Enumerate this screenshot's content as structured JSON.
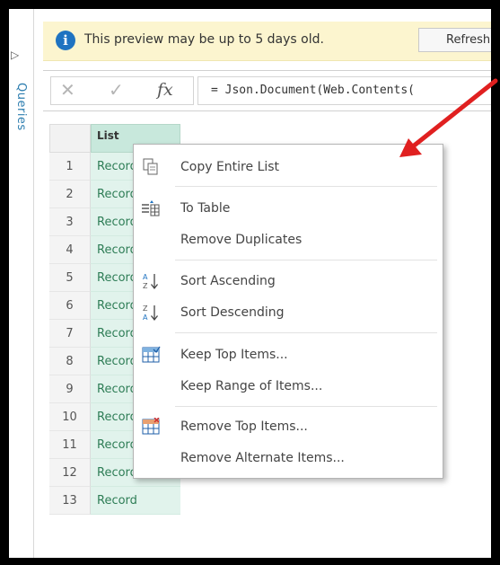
{
  "sidebar": {
    "label": "Queries"
  },
  "banner": {
    "message": "This preview may be up to 5 days old.",
    "refresh_label": "Refresh",
    "info_icon": "info-icon"
  },
  "formula_bar": {
    "formula": "= Json.Document(Web.Contents(",
    "fx_label": "fx"
  },
  "grid": {
    "column_header": "List",
    "rows": [
      {
        "num": "1",
        "value": "Record"
      },
      {
        "num": "2",
        "value": "Record"
      },
      {
        "num": "3",
        "value": "Record"
      },
      {
        "num": "4",
        "value": "Record"
      },
      {
        "num": "5",
        "value": "Record"
      },
      {
        "num": "6",
        "value": "Record"
      },
      {
        "num": "7",
        "value": "Record"
      },
      {
        "num": "8",
        "value": "Record"
      },
      {
        "num": "9",
        "value": "Record"
      },
      {
        "num": "10",
        "value": "Record"
      },
      {
        "num": "11",
        "value": "Record"
      },
      {
        "num": "12",
        "value": "Record"
      },
      {
        "num": "13",
        "value": "Record"
      }
    ]
  },
  "context_menu": {
    "items": [
      {
        "label": "Copy Entire List",
        "icon": "copy-icon"
      },
      {
        "label": "To Table",
        "icon": "to-table-icon"
      },
      {
        "label": "Remove Duplicates",
        "icon": ""
      },
      {
        "label": "Sort Ascending",
        "icon": "sort-ascending-icon"
      },
      {
        "label": "Sort Descending",
        "icon": "sort-descending-icon"
      },
      {
        "label": "Keep Top Items...",
        "icon": "keep-top-items-icon"
      },
      {
        "label": "Keep Range of Items...",
        "icon": ""
      },
      {
        "label": "Remove Top Items...",
        "icon": "remove-top-items-icon"
      },
      {
        "label": "Remove Alternate Items...",
        "icon": ""
      }
    ]
  },
  "colors": {
    "banner_bg": "#fcf5cf",
    "info_blue": "#1f73c1",
    "column_header_bg": "#c8e8dc",
    "cell_bg": "#e1f3ec",
    "record_text": "#2e7d56",
    "arrow_red": "#e02020"
  }
}
